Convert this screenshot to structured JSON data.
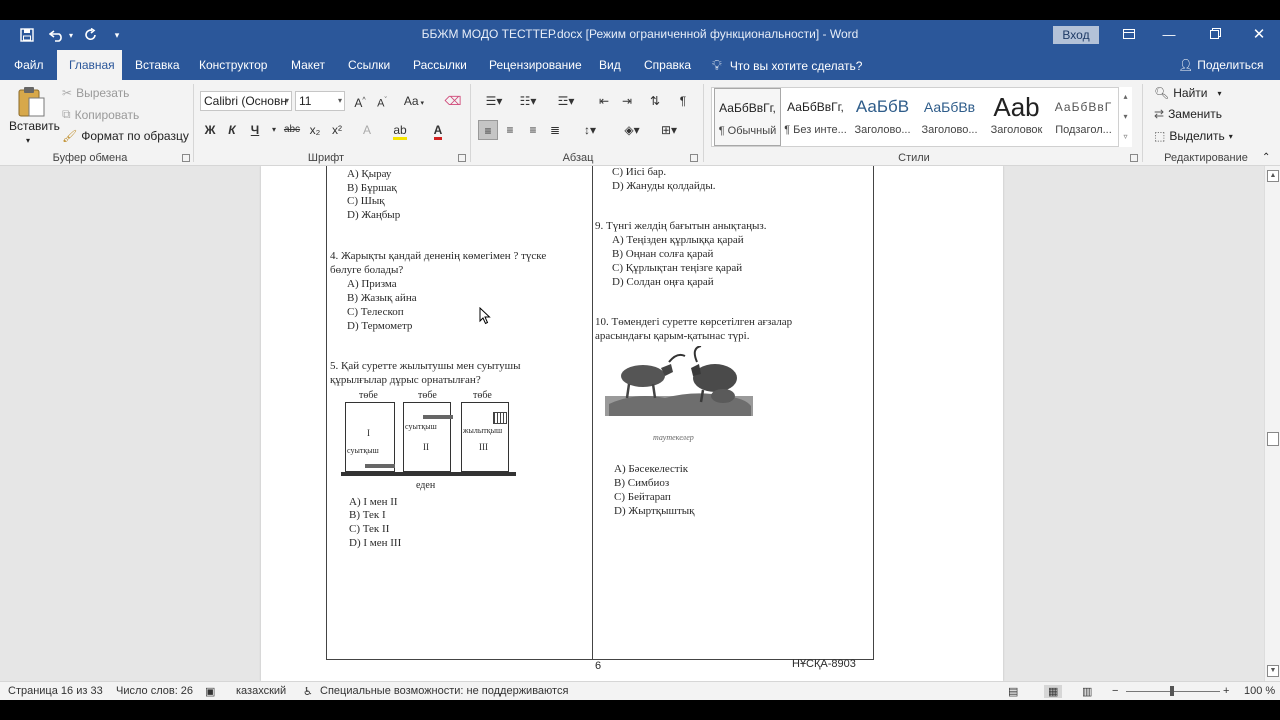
{
  "window": {
    "title": "ББЖМ  МОДО ТЕСТТЕР.docx [Режим ограниченной функциональности]  -  Word",
    "signin_label": "Вход"
  },
  "quick_access": {
    "icons": [
      "save-icon",
      "undo-icon",
      "redo-icon",
      "customize-icon"
    ]
  },
  "tabs": [
    {
      "label": "Файл"
    },
    {
      "label": "Главная"
    },
    {
      "label": "Вставка"
    },
    {
      "label": "Конструктор"
    },
    {
      "label": "Макет"
    },
    {
      "label": "Ссылки"
    },
    {
      "label": "Рассылки"
    },
    {
      "label": "Рецензирование"
    },
    {
      "label": "Вид"
    },
    {
      "label": "Справка"
    }
  ],
  "active_tab": "Главная",
  "tell_me": "Что вы хотите сделать?",
  "share_label": "Поделиться",
  "ribbon": {
    "clipboard": {
      "paste": "Вставить",
      "cut": "Вырезать",
      "copy": "Копировать",
      "format_painter": "Формат по образцу",
      "group_label": "Буфер обмена"
    },
    "font": {
      "font_name": "Calibri (Основн",
      "font_size": "11",
      "group_label": "Шрифт",
      "bold": "Ж",
      "italic": "К",
      "underline": "Ч",
      "strike": "abc",
      "subscript": "x₂",
      "superscript": "x²",
      "grow": "A",
      "shrink": "A",
      "case": "Aa"
    },
    "paragraph": {
      "group_label": "Абзац"
    },
    "styles": {
      "group_label": "Стили",
      "items": [
        {
          "sample": "АаБбВвГг,",
          "name": "¶ Обычный"
        },
        {
          "sample": "АаБбВвГг,",
          "name": "¶ Без инте..."
        },
        {
          "sample": "АаБбВ",
          "name": "Заголово..."
        },
        {
          "sample": "АаБбВв",
          "name": "Заголово..."
        },
        {
          "sample": "Aab",
          "name": "Заголовок"
        },
        {
          "sample": "АаБбВвГ",
          "name": "Подзагол..."
        }
      ]
    },
    "editing": {
      "find": "Найти",
      "replace": "Заменить",
      "select": "Выделить",
      "group_label": "Редактирование"
    }
  },
  "document": {
    "col1": {
      "q3_options": [
        "А)  Қырау",
        "В)  Бұршақ",
        "С)  Шық",
        "D)  Жаңбыр"
      ],
      "q4_text": [
        "4. Жарықты қандай дененің көмегімен ? түске",
        "бөлуге болады?"
      ],
      "q4_options": [
        "А)  Призма",
        "В)  Жазық айна",
        "С)  Телескоп",
        "D)  Термометр"
      ],
      "q5_text": [
        "5. Қай суретте жылытушы мен суытушы",
        "құрылғылар дұрыс орнатылған?"
      ],
      "figure_labels": {
        "top": "төбе",
        "floor": "еден",
        "cooler": "суытқыш",
        "heater": "жылытқыш",
        "panels": [
          "І",
          "ІІ",
          "ІІІ"
        ]
      },
      "q5_options": [
        "А)  І мен ІІ",
        "В)  Тек І",
        "С)  Тек ІІ",
        "D)  І мен ІІІ"
      ]
    },
    "col2": {
      "q8_options": [
        "С)  Иісі бар.",
        "D)  Жануды қолдайды."
      ],
      "q9_text": "9. Түнгі желдің бағытын анықтаңыз.",
      "q9_options": [
        "А)  Теңізден құрлыққа қарай",
        "В)  Оңнан солға қарай",
        "С)  Құрлықтан теңізге қарай",
        "D)  Солдан оңға қарай"
      ],
      "q10_text": [
        "10. Төмендегі суретте көрсетілген ағзалар",
        "арасындағы қарым-қатынас түрі."
      ],
      "q10_caption": "таутекелер",
      "q10_options": [
        "А)  Бәсекелестік",
        "В)  Симбиоз",
        "С)  Бейтарап",
        "D)  Жыртқыштық"
      ]
    },
    "page_number": "6",
    "variant": "НҰСҚА-8903"
  },
  "status": {
    "page": "Страница 16 из 33",
    "words": "Число слов: 26",
    "language": "казахский",
    "accessibility": "Специальные возможности: не поддерживаются",
    "zoom": "100 %"
  },
  "colors": {
    "accent": "#2b579a",
    "ribbon_bg": "#f3f3f3",
    "doc_bg": "#e6e6e6"
  }
}
